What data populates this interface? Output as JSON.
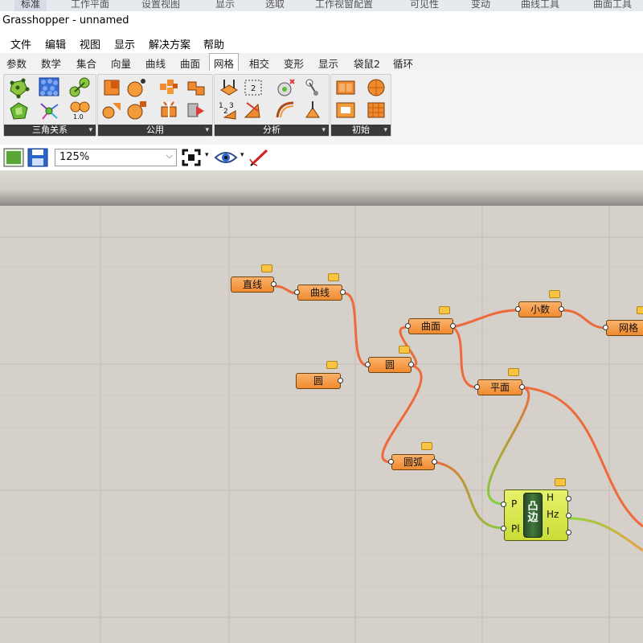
{
  "rhino_tabs": [
    "标准",
    "工作平面",
    "设置视图",
    "显示",
    "选取",
    "工作视窗配置",
    "可见性",
    "变动",
    "曲线工具",
    "曲面工具"
  ],
  "title": "Grasshopper - unnamed",
  "menu": [
    "文件",
    "编辑",
    "视图",
    "显示",
    "解决方案",
    "帮助"
  ],
  "tabs": [
    "参数",
    "数学",
    "集合",
    "向量",
    "曲线",
    "曲面",
    "网格",
    "相交",
    "变形",
    "显示",
    "袋鼠2",
    "循环"
  ],
  "selected_tab": "网格",
  "ribbon_groups": [
    "三角关系",
    "公用",
    "分析",
    "初始"
  ],
  "icon_texts": [
    "1.0",
    "2",
    "1",
    "2",
    "3"
  ],
  "zoom": "125%",
  "nodes": {
    "line": "直线",
    "curve": "曲线",
    "surface": "曲面",
    "decimal": "小数",
    "mesh": "网格",
    "circle1": "圆",
    "circle2": "圆",
    "plane": "平面",
    "arc": "圆弧"
  },
  "component": {
    "name": "凸边",
    "inputs": [
      "P",
      "Pl"
    ],
    "outputs": [
      "H",
      "Hz",
      "I"
    ]
  },
  "colors": {
    "node_orange": "#f08a2e",
    "component_green": "#d4e84a",
    "wire": "#ee6a3a",
    "canvas": "#d5d0c9"
  }
}
